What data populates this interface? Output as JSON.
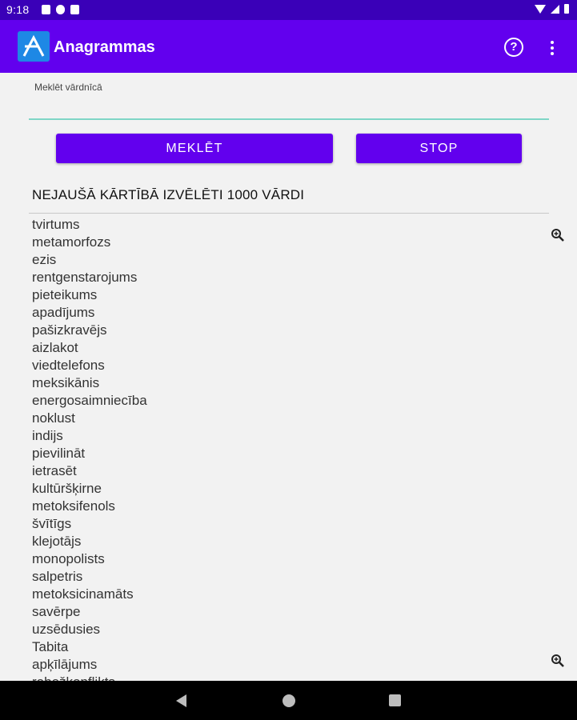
{
  "status_bar": {
    "time": "9:18"
  },
  "app_bar": {
    "title": "Anagrammas"
  },
  "search": {
    "label": "Meklēt vārdnīcā",
    "value": "",
    "placeholder": ""
  },
  "buttons": {
    "search_label": "MEKLĒT",
    "stop_label": "STOP"
  },
  "list": {
    "heading": "NEJAUŠĀ KĀRTĪBĀ IZVĒLĒTI 1000 VĀRDI",
    "words": [
      "tvirtums",
      "metamorfozs",
      "ezis",
      "rentgenstarojums",
      "pieteikums",
      "apadījums",
      "pašizkravējs",
      "aizlakot",
      "viedtelefons",
      "meksikānis",
      "energosaimniecība",
      "noklust",
      "indijs",
      "pievilināt",
      "ietrasēt",
      "kultūršķirne",
      "metoksifenols",
      "švītīgs",
      "klejotājs",
      "monopolists",
      "salpetris",
      "metoksicinamāts",
      "savērpe",
      "uzsēdusies",
      "Tabita",
      "apķīlājums",
      "robežkonflikts"
    ]
  },
  "icons": {
    "app": "app-logo-icon",
    "help": "help-icon",
    "more": "more-vert-icon",
    "zoom": "zoom-in-icon"
  },
  "colors": {
    "app_bar": "#6200ee",
    "status_bar": "#3a00b8",
    "accent_underline": "#7fd6c6",
    "button": "#6200ee"
  }
}
